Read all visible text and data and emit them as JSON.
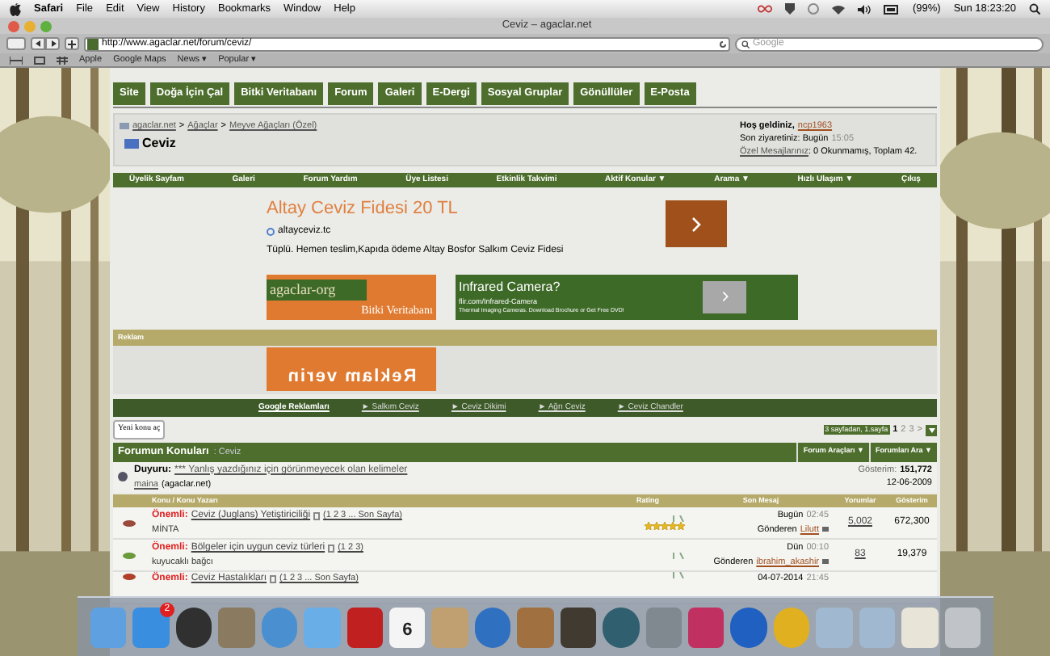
{
  "menubar": {
    "app": "Safari",
    "menus": [
      "File",
      "Edit",
      "View",
      "History",
      "Bookmarks",
      "Window",
      "Help"
    ],
    "battery": "(99%)",
    "clock": "Sun 18:23:20"
  },
  "window": {
    "title": "Ceviz – agaclar.net"
  },
  "toolbar": {
    "url": "http://www.agaclar.net/forum/ceviz/",
    "search_placeholder": "Google"
  },
  "bookmarks": [
    "Apple",
    "Google Maps",
    "News ▾",
    "Popular ▾"
  ],
  "site_tabs": [
    "Site",
    "Doğa İçin Çal",
    "Bitki Veritabanı",
    "Forum",
    "Galeri",
    "E-Dergi",
    "Sosyal Gruplar",
    "Gönüllüler",
    "E-Posta"
  ],
  "breadcrumb": {
    "links": [
      "agaclar.net",
      "Ağaçlar",
      "Meyve Ağaçları (Özel)"
    ],
    "separator": ">",
    "title": "Ceviz"
  },
  "welcome": {
    "greeting": "Hoş geldiniz,",
    "user": "ncp1963",
    "last_visit": "Son ziyaretiniz: Bugün",
    "last_visit_time": "15:05",
    "pm_link": "Özel Mesajlarınız",
    "pm_text": ": 0 Okunmamış, Toplam 42."
  },
  "nav": [
    "Üyelik Sayfam",
    "Galeri",
    "Forum Yardım",
    "Üye Listesi",
    "Etkinlik Takvimi",
    "Aktif Konular ▼",
    "Arama ▼",
    "Hızlı Ulaşım ▼",
    "Çıkış"
  ],
  "ad_text": {
    "title": "Altay Ceviz Fidesi 20 TL",
    "url": "altayceviz.tc",
    "description": "Tüplü. Hemen teslim,Kapıda ödeme Altay Bosfor Salkım Ceviz Fidesi"
  },
  "banner": {
    "title": "agaclar-org",
    "subtitle": "Bitki Veritabanı"
  },
  "ad_camera": {
    "title": "Infrared Camera?",
    "url": "flir.com/Infrared-Camera",
    "description": "Thermal Imaging Cameras. Download Brochure or Get Free DVD!"
  },
  "reklam": {
    "heading": "Reklam",
    "banner": "Reklam verin"
  },
  "ad_links": {
    "label": "Google Reklamları",
    "links": [
      "► Salkım Ceviz",
      "► Ceviz Dikimi",
      "► Ağrı Ceviz",
      "► Ceviz Chandler"
    ]
  },
  "new_topic_button": "Yeni konu aç",
  "pagination": {
    "label": "3 sayfadan, 1.sayfa",
    "pages": [
      {
        "label": "1",
        "selected": true
      },
      {
        "label": "2",
        "selected": false
      },
      {
        "label": "3",
        "selected": false
      }
    ],
    "next": ">"
  },
  "forum_header": {
    "title": "Forumun Konuları",
    "subtitle": ": Ceviz",
    "tools": [
      "Forum Araçları ▼",
      "Forumları Ara ▼"
    ]
  },
  "announcement": {
    "label": "Duyuru:",
    "title": "*** Yanlış yazdığınız için görünmeyecek olan kelimeler",
    "author": "maina",
    "author_suffix": "(agaclar.net)",
    "views_label": "Gösterim:",
    "views": "151,772",
    "date": "12-06-2009"
  },
  "columns": [
    "Konu / Konu Yazarı",
    "Rating",
    "Son Mesaj",
    "Yorumlar",
    "Gösterim"
  ],
  "rows": [
    {
      "color": "#9a4a3a",
      "prefix": "Önemli:",
      "title": "Ceviz (Juglans) Yetiştiriciliği",
      "pages": "(1 2 3 ... Son Sayfa)",
      "author": "MİNTA",
      "stars": 5,
      "last_date": "Bugün",
      "last_time": "02:45",
      "by_label": "Gönderen",
      "by": "Lilutt",
      "replies": "5,002",
      "views": "672,300"
    },
    {
      "color": "#6a9a3a",
      "prefix": "Önemli:",
      "title": "Bölgeler için uygun ceviz türleri",
      "pages": "(1 2 3)",
      "author": "kuyucaklı bağcı",
      "last_date": "Dün",
      "last_time": "00:10",
      "by_label": "Gönderen",
      "by": "ibrahim_akashir",
      "replies": "83",
      "views": "19,379"
    },
    {
      "color": "#b0402a",
      "prefix": "Önemli:",
      "title": "Ceviz Hastalıkları",
      "pages": "(1 2 3 ... Son Sayfa)",
      "last_date": "04-07-2014",
      "last_time": "21:45"
    }
  ],
  "dock": {
    "badge": "2",
    "calendar_day": "6"
  }
}
